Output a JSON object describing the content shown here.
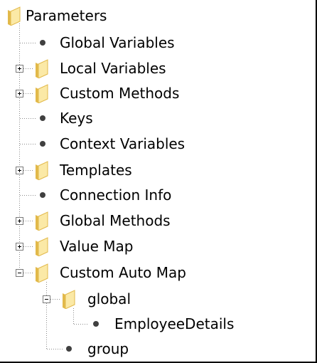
{
  "tree": {
    "root": {
      "label": "Parameters",
      "icon": "folder-icon"
    },
    "items": [
      {
        "label": "Global Variables",
        "type": "leaf",
        "icon": "bullet-icon"
      },
      {
        "label": "Local Variables",
        "type": "folder",
        "expanded": false,
        "icon": "folder-icon"
      },
      {
        "label": "Custom Methods",
        "type": "folder",
        "expanded": false,
        "icon": "folder-icon"
      },
      {
        "label": "Keys",
        "type": "leaf",
        "icon": "bullet-icon"
      },
      {
        "label": "Context Variables",
        "type": "leaf",
        "icon": "bullet-icon"
      },
      {
        "label": "Templates",
        "type": "folder",
        "expanded": false,
        "icon": "folder-icon"
      },
      {
        "label": "Connection Info",
        "type": "leaf",
        "icon": "bullet-icon"
      },
      {
        "label": "Global Methods",
        "type": "folder",
        "expanded": false,
        "icon": "folder-icon"
      },
      {
        "label": "Value Map",
        "type": "folder",
        "expanded": false,
        "icon": "folder-icon"
      },
      {
        "label": "Custom Auto Map",
        "type": "folder",
        "expanded": true,
        "icon": "folder-icon",
        "children": [
          {
            "label": "global",
            "type": "folder",
            "expanded": true,
            "icon": "folder-icon",
            "children": [
              {
                "label": "EmployeeDetails",
                "type": "leaf",
                "icon": "bullet-icon"
              }
            ]
          },
          {
            "label": "group",
            "type": "leaf",
            "icon": "bullet-icon"
          }
        ]
      }
    ]
  },
  "colors": {
    "folder_light": "#fbe9a6",
    "folder_dark": "#e2b94a",
    "tree_lines": "#8a8a8a",
    "bullet": "#404040",
    "border": "#000000"
  }
}
